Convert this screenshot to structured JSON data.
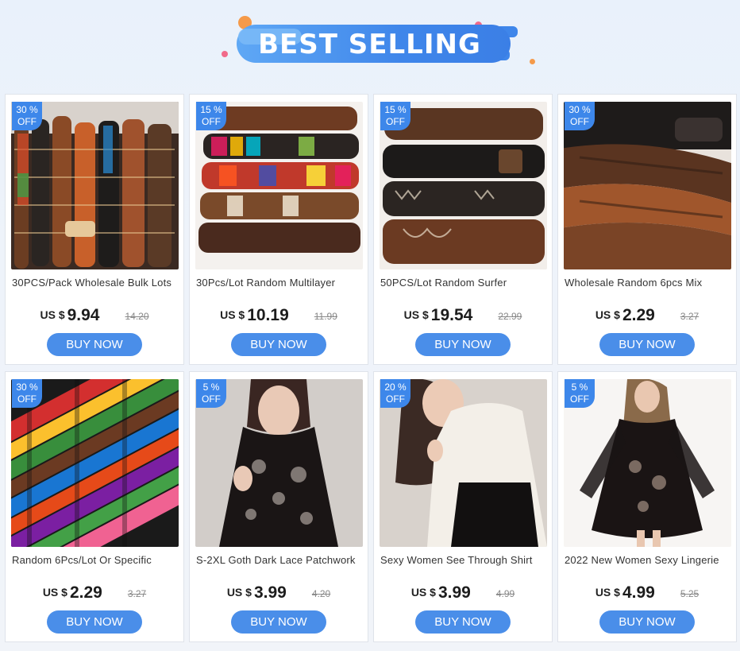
{
  "banner": {
    "title": "BEST SELLING"
  },
  "colors": {
    "accent": "#3d87ea",
    "button": "#4a8ee9",
    "banner_start": "#5fa8f5",
    "banner_end": "#3b7fe6",
    "dot_orange": "#f59a4a",
    "dot_pink": "#f16a8a"
  },
  "products": [
    {
      "discount": "30 %",
      "off": "OFF",
      "name": "30PCS/Pack Wholesale Bulk Lots",
      "currency": "US $",
      "price": "9.94",
      "old_price": "14.20",
      "button": "BUY NOW",
      "image": "leather-bracelets-pile"
    },
    {
      "discount": "15 %",
      "off": "OFF",
      "name": "30Pcs/Lot Random Multilayer",
      "currency": "US $",
      "price": "10.19",
      "old_price": "11.99",
      "button": "BUY NOW",
      "image": "colorful-bracelets-rows"
    },
    {
      "discount": "15 %",
      "off": "OFF",
      "name": "50PCS/Lot Random Surfer",
      "currency": "US $",
      "price": "19.54",
      "old_price": "22.99",
      "button": "BUY NOW",
      "image": "dark-leather-bracelets"
    },
    {
      "discount": "30 %",
      "off": "OFF",
      "name": "Wholesale Random 6pcs Mix",
      "currency": "US $",
      "price": "2.29",
      "old_price": "3.27",
      "button": "BUY NOW",
      "image": "brown-leather-bracelets"
    },
    {
      "discount": "30 %",
      "off": "OFF",
      "name": "Random 6Pcs/Lot Or Specific",
      "currency": "US $",
      "price": "2.29",
      "old_price": "3.27",
      "button": "BUY NOW",
      "image": "rainbow-woven-bracelets"
    },
    {
      "discount": "5 %",
      "off": "OFF",
      "name": "S-2XL Goth Dark Lace Patchwork",
      "currency": "US $",
      "price": "3.99",
      "old_price": "4.20",
      "button": "BUY NOW",
      "image": "black-lace-top"
    },
    {
      "discount": "20 %",
      "off": "OFF",
      "name": "Sexy Women See Through Shirt",
      "currency": "US $",
      "price": "3.99",
      "old_price": "4.99",
      "button": "BUY NOW",
      "image": "white-sheer-shirt"
    },
    {
      "discount": "5 %",
      "off": "OFF",
      "name": "2022 New Women Sexy Lingerie",
      "currency": "US $",
      "price": "4.99",
      "old_price": "5.25",
      "button": "BUY NOW",
      "image": "black-lace-dress"
    }
  ]
}
